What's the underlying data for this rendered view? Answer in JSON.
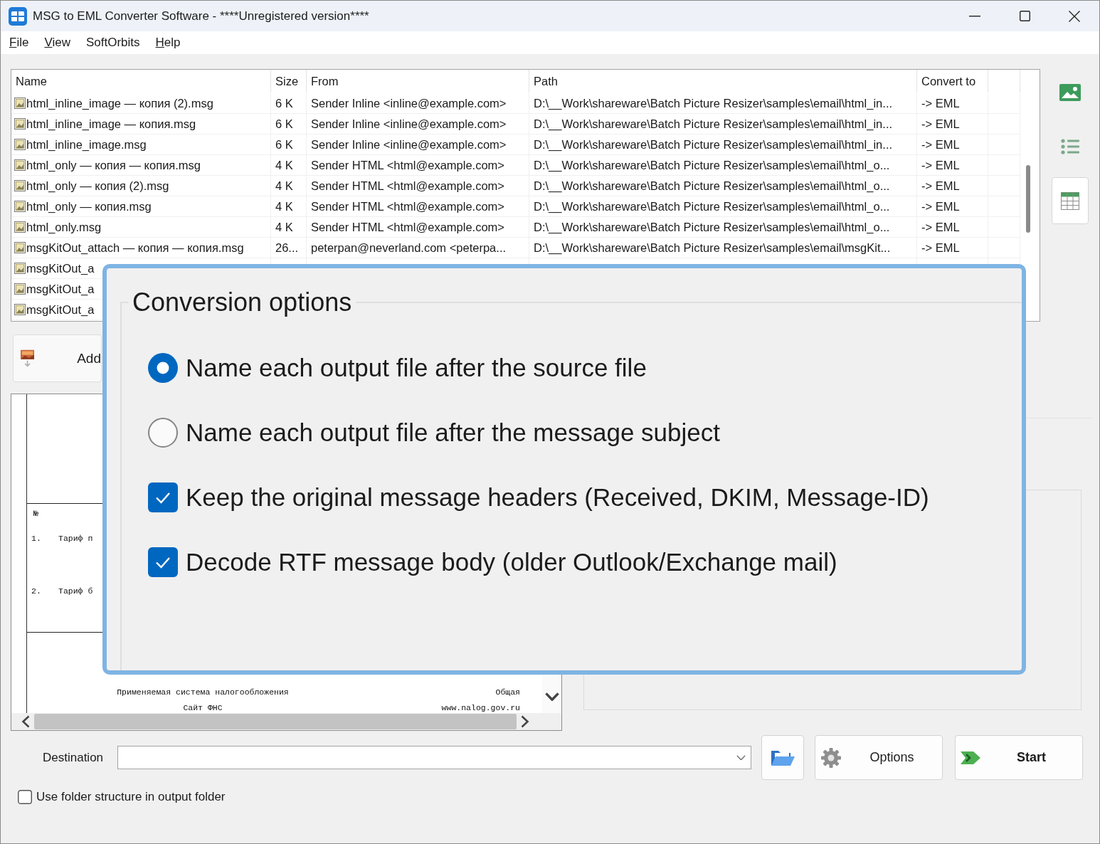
{
  "window": {
    "title": "MSG to EML Converter Software - ****Unregistered version****"
  },
  "menu": [
    {
      "label": "File",
      "underline_first": true
    },
    {
      "label": "View",
      "underline_first": true
    },
    {
      "label": "SoftOrbits",
      "underline_first": false
    },
    {
      "label": "Help",
      "underline_first": true
    }
  ],
  "file_table": {
    "columns": [
      "Name",
      "Size",
      "From",
      "Path",
      "Convert to"
    ],
    "rows": [
      {
        "name": "html_inline_image — копия (2).msg",
        "size": "6 K",
        "from": "Sender Inline <inline@example.com>",
        "path": "D:\\__Work\\shareware\\Batch Picture Resizer\\samples\\email\\html_in...",
        "convert_to": "-> EML"
      },
      {
        "name": "html_inline_image — копия.msg",
        "size": "6 K",
        "from": "Sender Inline <inline@example.com>",
        "path": "D:\\__Work\\shareware\\Batch Picture Resizer\\samples\\email\\html_in...",
        "convert_to": "-> EML"
      },
      {
        "name": "html_inline_image.msg",
        "size": "6 K",
        "from": "Sender Inline <inline@example.com>",
        "path": "D:\\__Work\\shareware\\Batch Picture Resizer\\samples\\email\\html_in...",
        "convert_to": "-> EML"
      },
      {
        "name": "html_only — копия — копия.msg",
        "size": "4 K",
        "from": "Sender HTML <html@example.com>",
        "path": "D:\\__Work\\shareware\\Batch Picture Resizer\\samples\\email\\html_o...",
        "convert_to": "-> EML"
      },
      {
        "name": "html_only — копия (2).msg",
        "size": "4 K",
        "from": "Sender HTML <html@example.com>",
        "path": "D:\\__Work\\shareware\\Batch Picture Resizer\\samples\\email\\html_o...",
        "convert_to": "-> EML"
      },
      {
        "name": "html_only — копия.msg",
        "size": "4 K",
        "from": "Sender HTML <html@example.com>",
        "path": "D:\\__Work\\shareware\\Batch Picture Resizer\\samples\\email\\html_o...",
        "convert_to": "-> EML"
      },
      {
        "name": "html_only.msg",
        "size": "4 K",
        "from": "Sender HTML <html@example.com>",
        "path": "D:\\__Work\\shareware\\Batch Picture Resizer\\samples\\email\\html_o...",
        "convert_to": "-> EML"
      },
      {
        "name": "msgKitOut_attach — копия — копия.msg",
        "size": "26...",
        "from": "peterpan@neverland.com <peterpa...",
        "path": "D:\\__Work\\shareware\\Batch Picture Resizer\\samples\\email\\msgKit...",
        "convert_to": "-> EML"
      },
      {
        "name": "msgKitOut_a"
      },
      {
        "name": "msgKitOut_a"
      },
      {
        "name": "msgKitOut_a"
      }
    ]
  },
  "view_buttons": [
    {
      "kind": "thumbnails",
      "selected": false
    },
    {
      "kind": "list",
      "selected": false
    },
    {
      "kind": "table",
      "selected": true
    }
  ],
  "add_button": {
    "label": "Add"
  },
  "preview": {
    "number_heading": "№",
    "items": [
      {
        "number": "1.",
        "text": "Тариф п"
      },
      {
        "number": "2.",
        "text": "Тариф б"
      }
    ],
    "rows": [
      {
        "label": "Применяемая система налогообложения",
        "value": "Общая"
      },
      {
        "label": "Сайт ФНС",
        "value": "www.nalog.gov.ru"
      }
    ]
  },
  "destination": {
    "label": "Destination"
  },
  "actions": [
    {
      "kind": "browse"
    },
    {
      "kind": "options",
      "label": "Options"
    },
    {
      "kind": "start",
      "label": "Start"
    }
  ],
  "use_folder_structure": {
    "label": "Use folder structure in output folder",
    "checked": false
  },
  "conversion_options": {
    "title": "Conversion options",
    "naming": [
      {
        "label": "Name each output file after the source file",
        "selected": true
      },
      {
        "label": "Name each output file after the message subject",
        "selected": false
      }
    ],
    "checkboxes": [
      {
        "label": "Keep the original message headers (Received, DKIM, Message-ID)",
        "checked": true
      },
      {
        "label": "Decode RTF message body (older Outlook/Exchange mail)",
        "checked": true
      }
    ]
  }
}
